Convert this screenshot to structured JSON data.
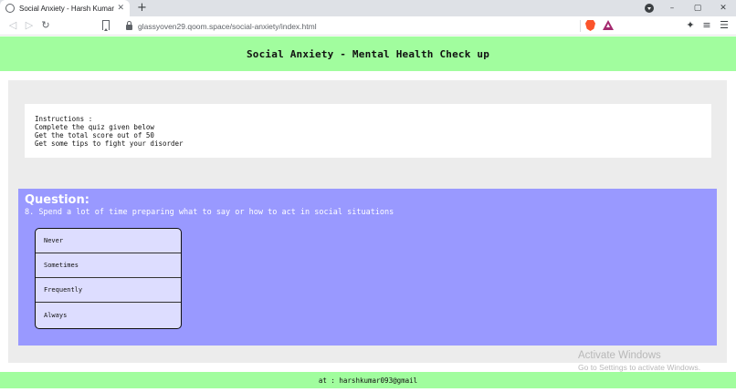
{
  "browser": {
    "tab_title": "Social Anxiety - Harsh Kumar",
    "tab_close": "✕",
    "new_tab": "+",
    "url": "glassyoven29.qoom.space/social-anxiety/index.html",
    "window_controls": [
      "–",
      "▢",
      "✕"
    ]
  },
  "header": {
    "title": "Social Anxiety - Mental Health Check up",
    "background": "#a1fd9e"
  },
  "instructions": {
    "lines": [
      "Instructions :",
      "Complete the quiz given below",
      "Get the total score out of 50",
      "Get some tips to fight your disorder"
    ]
  },
  "quiz": {
    "heading": "Question:",
    "question": "8. Spend a lot of time preparing what to say or how to act in social situations",
    "options": [
      "Never",
      "Sometimes",
      "Frequently",
      "Always"
    ],
    "background": "#9999ff"
  },
  "watermark": {
    "title": "Activate Windows",
    "subtitle": "Go to Settings to activate Windows."
  },
  "footer": {
    "text": "at : harshkumar093@gmail"
  }
}
